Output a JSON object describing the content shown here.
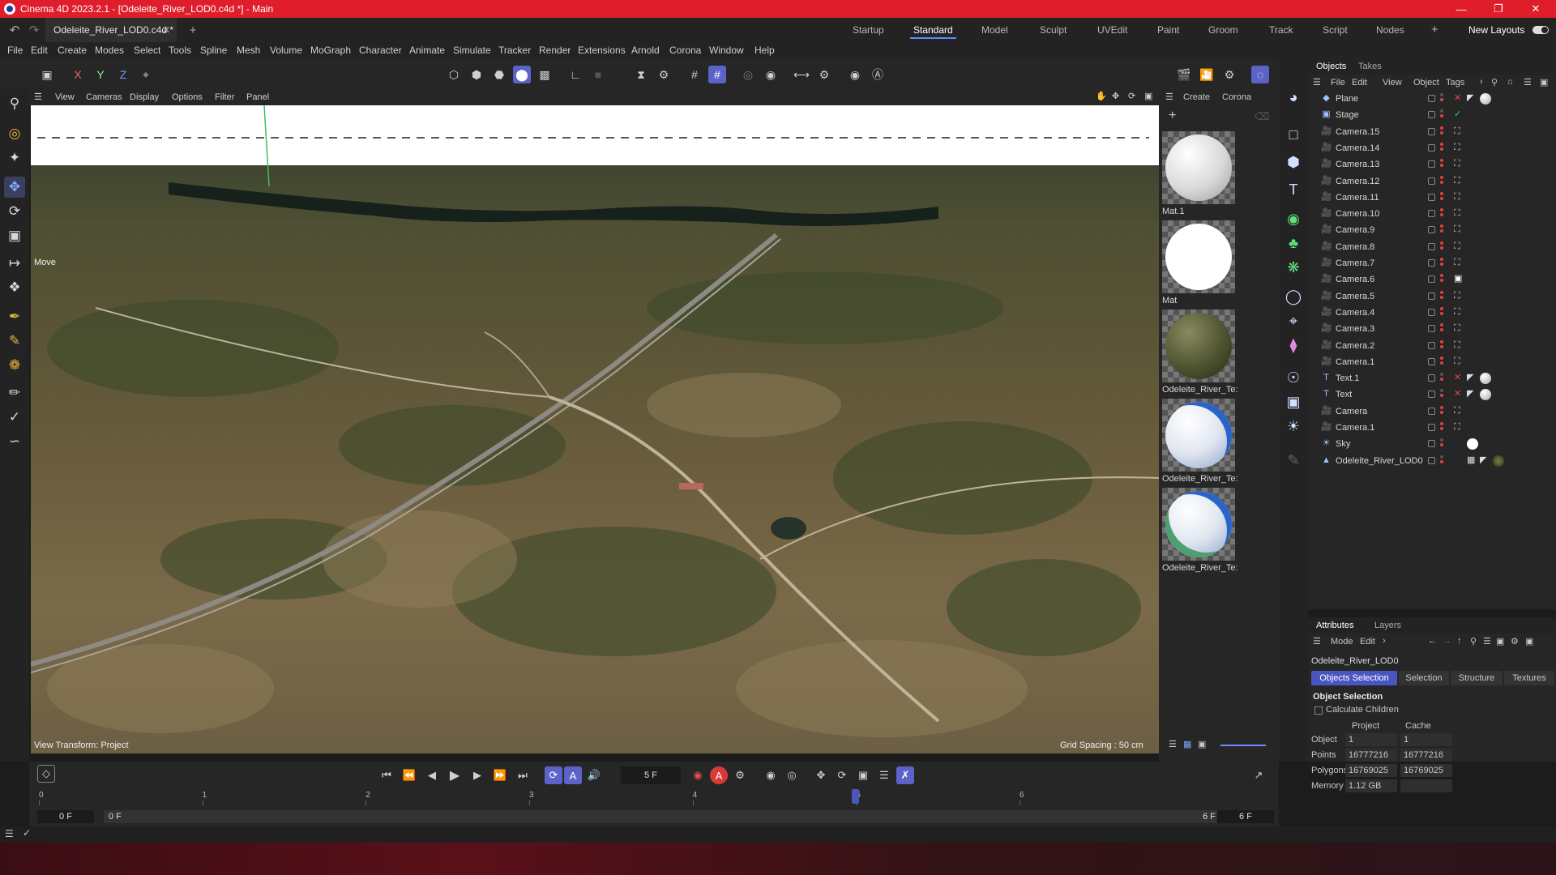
{
  "window": {
    "title": "Cinema 4D 2023.2.1 - [Odeleite_River_LOD0.c4d *] - Main"
  },
  "doc_tab": {
    "name": "Odeleite_River_LOD0.c4d *"
  },
  "layouts": [
    "Startup",
    "Standard",
    "Model",
    "Sculpt",
    "UVEdit",
    "Paint",
    "Groom",
    "Track",
    "Script",
    "Nodes"
  ],
  "active_layout": "Standard",
  "new_layouts": "New Layouts",
  "menu": [
    "File",
    "Edit",
    "Create",
    "Modes",
    "Select",
    "Tools",
    "Spline",
    "Mesh",
    "Volume",
    "MoGraph",
    "Character",
    "Animate",
    "Simulate",
    "Tracker",
    "Render",
    "Extensions",
    "Arnold",
    "Corona",
    "Window",
    "Help"
  ],
  "toolbar": {
    "x": "X",
    "y": "Y",
    "z": "Z"
  },
  "viewport_menu": [
    "View",
    "Cameras",
    "Display",
    "Options",
    "Filter",
    "Panel"
  ],
  "viewport": {
    "mode_label": "Move",
    "view_transform": "View Transform: Project",
    "grid_spacing": "Grid Spacing : 50 cm"
  },
  "material_menu": [
    "Create",
    "Corona"
  ],
  "materials": [
    {
      "name": "Mat.1",
      "style": "white-matte"
    },
    {
      "name": "Mat",
      "style": "white-flat"
    },
    {
      "name": "Odeleite_River_Te:",
      "style": "terrain"
    },
    {
      "name": "Odeleite_River_Te:",
      "style": "river-blue"
    },
    {
      "name": "Odeleite_River_Te:",
      "style": "river-blue-green"
    }
  ],
  "objects_panel": {
    "tabs": [
      "Objects",
      "Takes"
    ],
    "menu": [
      "File",
      "Edit",
      "View",
      "Object",
      "Tags"
    ],
    "rows": [
      {
        "name": "Plane",
        "icon": "plane-icon",
        "tags": "x-mat"
      },
      {
        "name": "Stage",
        "icon": "stage-icon",
        "tags": "check"
      },
      {
        "name": "Camera.15",
        "icon": "camera-icon",
        "tags": "target"
      },
      {
        "name": "Camera.14",
        "icon": "camera-icon",
        "tags": "target"
      },
      {
        "name": "Camera.13",
        "icon": "camera-icon",
        "tags": "target"
      },
      {
        "name": "Camera.12",
        "icon": "camera-icon",
        "tags": "target"
      },
      {
        "name": "Camera.11",
        "icon": "camera-icon",
        "tags": "target"
      },
      {
        "name": "Camera.10",
        "icon": "camera-icon",
        "tags": "target"
      },
      {
        "name": "Camera.9",
        "icon": "camera-icon",
        "tags": "target"
      },
      {
        "name": "Camera.8",
        "icon": "camera-icon",
        "tags": "target"
      },
      {
        "name": "Camera.7",
        "icon": "camera-icon",
        "tags": "target"
      },
      {
        "name": "Camera.6",
        "icon": "camera-icon",
        "tags": "target-active"
      },
      {
        "name": "Camera.5",
        "icon": "camera-icon",
        "tags": "target"
      },
      {
        "name": "Camera.4",
        "icon": "camera-icon",
        "tags": "target"
      },
      {
        "name": "Camera.3",
        "icon": "camera-icon",
        "tags": "target"
      },
      {
        "name": "Camera.2",
        "icon": "camera-icon",
        "tags": "target"
      },
      {
        "name": "Camera.1",
        "icon": "camera-icon",
        "tags": "target"
      },
      {
        "name": "Text.1",
        "icon": "text-icon",
        "tags": "x-mat"
      },
      {
        "name": "Text",
        "icon": "text-icon",
        "tags": "x-mat"
      },
      {
        "name": "Camera",
        "icon": "camera-icon",
        "tags": "target"
      },
      {
        "name": "Camera.1",
        "icon": "camera-icon",
        "tags": "target"
      },
      {
        "name": "Sky",
        "icon": "sky-icon",
        "tags": "white-mat"
      },
      {
        "name": "Odeleite_River_LOD0",
        "icon": "mesh-icon",
        "tags": "terrain-mat"
      }
    ]
  },
  "attributes": {
    "tabs": [
      "Attributes",
      "Layers"
    ],
    "menu": [
      "Mode",
      "Edit"
    ],
    "object_name": "Odeleite_River_LOD0",
    "sub_tabs": [
      "Objects Selection",
      "Selection",
      "Structure",
      "Textures"
    ],
    "section": "Object Selection",
    "calc_children": "Calculate Children",
    "columns": [
      "Project",
      "Cache"
    ],
    "rows": [
      {
        "label": "Object",
        "project": "1",
        "cache": "1"
      },
      {
        "label": "Points",
        "project": "16777216",
        "cache": "16777216"
      },
      {
        "label": "Polygons",
        "project": "16769025",
        "cache": "16769025"
      },
      {
        "label": "Memory",
        "project": "1.12 GB",
        "cache": ""
      }
    ]
  },
  "timeline": {
    "current_frame": "5 F",
    "ticks": [
      "0",
      "1",
      "2",
      "3",
      "4",
      "5",
      "6"
    ],
    "playhead_frame": 5,
    "start": "0 F",
    "range_start": "0 F",
    "range_end": "6 F",
    "end": "6 F"
  },
  "colors": {
    "accent": "#5b63c8",
    "titlebar": "#e01e2b",
    "panel": "#262626"
  }
}
